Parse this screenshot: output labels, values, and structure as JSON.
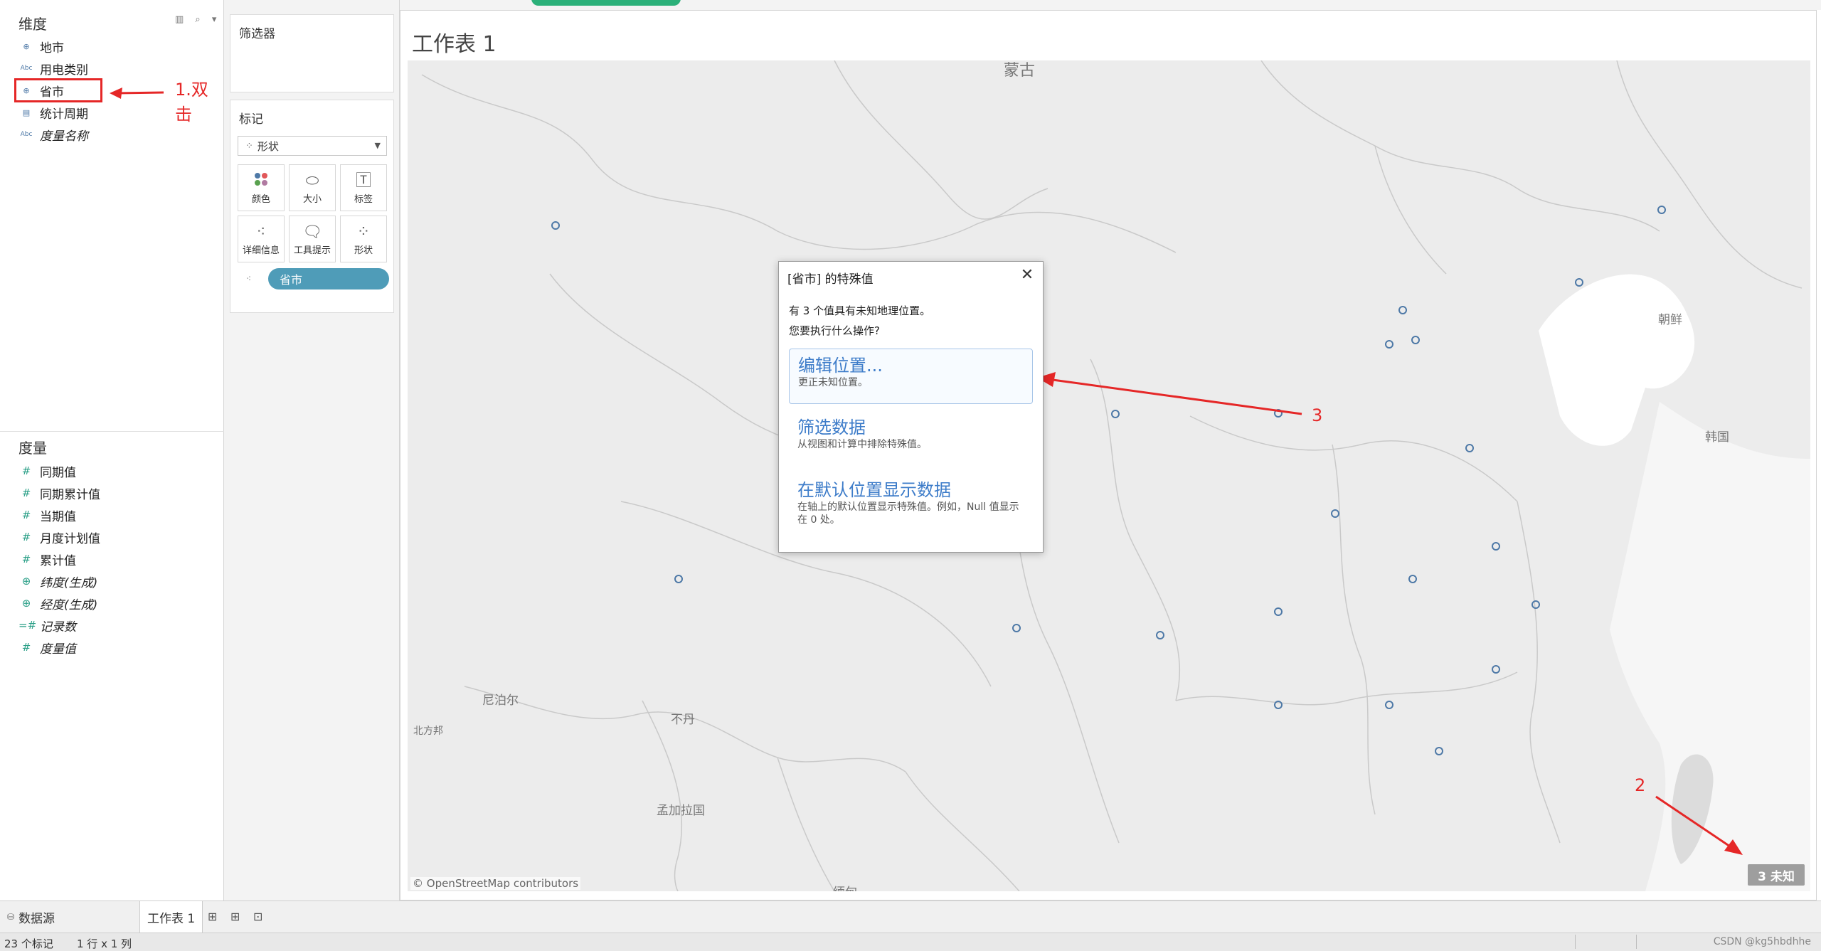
{
  "data_pane": {
    "dimensions_title": "维度",
    "tools": "▥ ⌕ ▾",
    "dimensions": [
      {
        "label": "地市",
        "icon": "globe-icon",
        "italic": false
      },
      {
        "label": "用电类别",
        "icon": "abc-icon",
        "italic": false
      },
      {
        "label": "省市",
        "icon": "globe-icon",
        "italic": false
      },
      {
        "label": "统计周期",
        "icon": "calendar-icon",
        "italic": false
      },
      {
        "label": "度量名称",
        "icon": "abc-icon",
        "italic": true
      }
    ],
    "measures_title": "度量",
    "measures": [
      {
        "label": "同期值",
        "italic": false
      },
      {
        "label": "同期累计值",
        "italic": false
      },
      {
        "label": "当期值",
        "italic": false
      },
      {
        "label": "月度计划值",
        "italic": false
      },
      {
        "label": "累计值",
        "italic": false
      },
      {
        "label": "纬度(生成)",
        "italic": true
      },
      {
        "label": "经度(生成)",
        "italic": true
      },
      {
        "label": "记录数",
        "italic": true
      },
      {
        "label": "度量值",
        "italic": true
      }
    ]
  },
  "shelves": {
    "filters_title": "筛选器",
    "marks_title": "标记",
    "mark_type": "形状",
    "mark_buttons": {
      "color": "颜色",
      "size": "大小",
      "label": "标签",
      "detail": "详细信息",
      "tooltip": "工具提示",
      "shape": "形状"
    },
    "pill": "省市"
  },
  "worksheet": {
    "title": "工作表 1",
    "map_labels": {
      "mongolia": "蒙古",
      "north_korea": "朝鲜",
      "south_korea": "韩国",
      "nepal": "尼泊尔",
      "bhutan": "不丹",
      "bangladesh": "孟加拉国",
      "north_side": "北方邦",
      "bottom_partial": "缅甸"
    },
    "attribution": "© OpenStreetMap contributors",
    "unknown_badge": "3 未知"
  },
  "dialog": {
    "title": "[省市] 的特殊值",
    "message_line1": "有 3 个值具有未知地理位置。",
    "message_line2": "您要执行什么操作?",
    "options": [
      {
        "title": "编辑位置...",
        "desc": "更正未知位置。"
      },
      {
        "title": "筛选数据",
        "desc": "从视图和计算中排除特殊值。"
      },
      {
        "title": "在默认位置显示数据",
        "desc": "在轴上的默认位置显示特殊值。例如，Null 值显示在 0 处。"
      }
    ]
  },
  "annotations": {
    "step1": "1.双击",
    "step2": "2",
    "step3": "3",
    "color": "#e52727"
  },
  "tabs": {
    "datasource": "数据源",
    "sheet1": "工作表 1"
  },
  "status": {
    "marks": "23 个标记",
    "rows_cols": "1 行 x 1 列",
    "watermark": "CSDN @kg5hbdhhe"
  }
}
